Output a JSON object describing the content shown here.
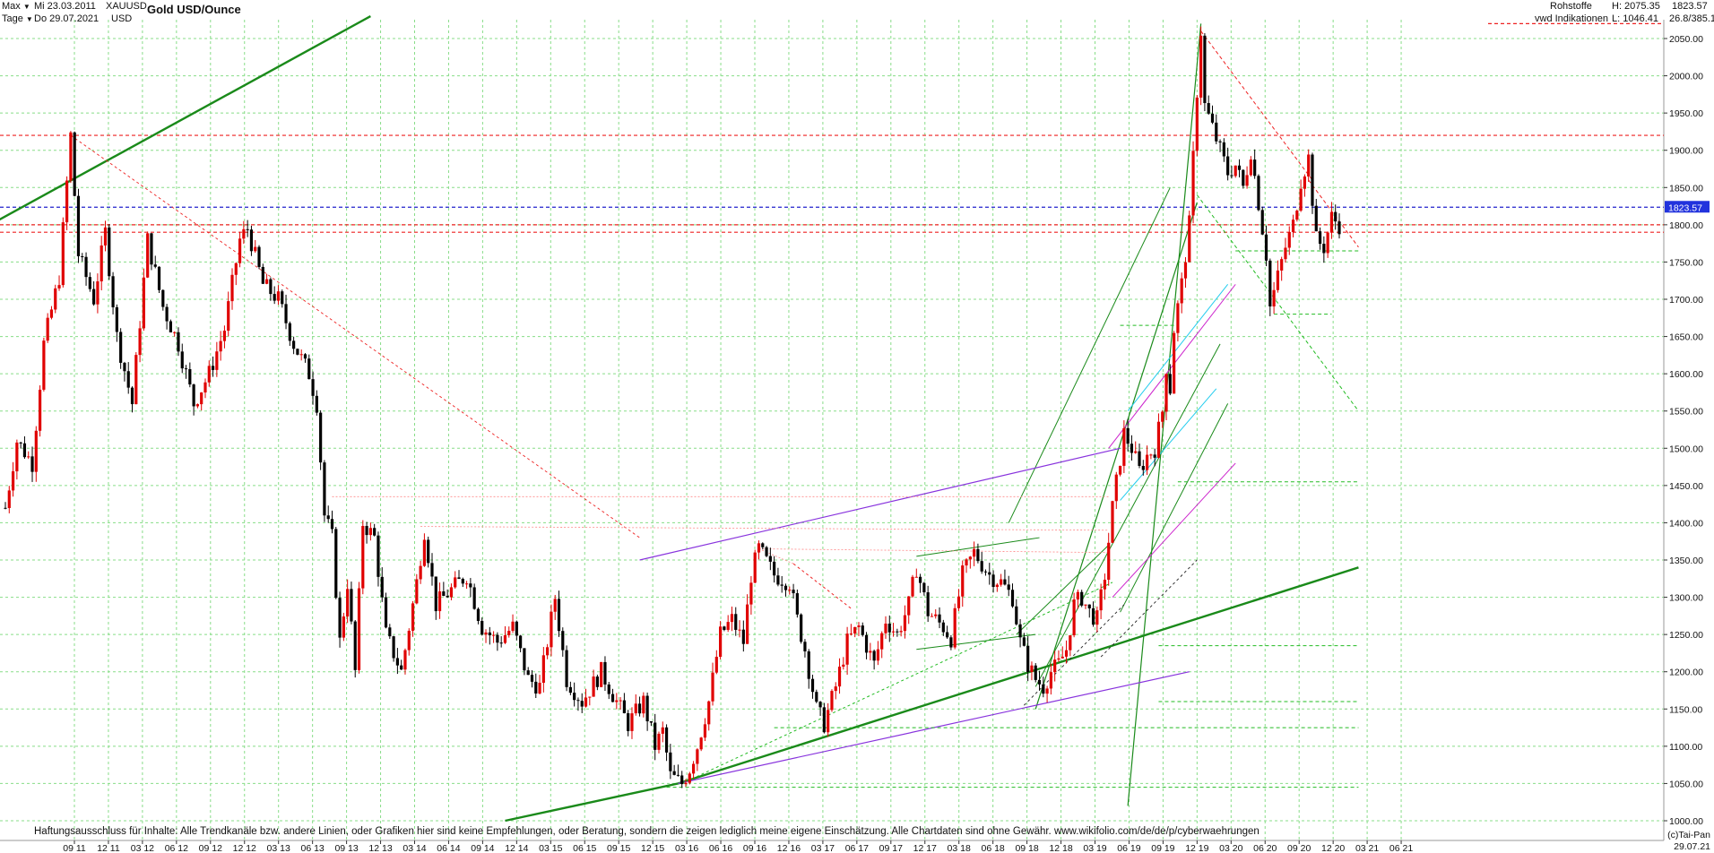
{
  "header": {
    "range_label": "Max",
    "interval_label": "Tage",
    "date_from": "Mi 23.03.2011",
    "date_to": "Do 29.07.2021",
    "symbol": "XAUUSD",
    "currency": "USD",
    "title": "Gold USD/Ounce",
    "category": "Rohstoffe",
    "source": "vwd Indikationen",
    "high": "H: 2075.35",
    "low": "L: 1046.41",
    "last": "1823.57",
    "ratio": "26.8/385.1"
  },
  "footer": {
    "disclaimer": "Haftungsausschluss für Inhalte: Alle Trendkanäle bzw. andere Linien, oder Grafiken hier sind keine Empfehlungen, oder Beratung, sondern die zeigen lediglich meine eigene Einschätzung. Alle Chartdaten sind ohne Gewähr.  www.wikifolio.com/de/de/p/cyberwaehrungen",
    "copyright": "(c)Tai-Pan",
    "end_date": "29.07.21"
  },
  "colors": {
    "background": "#ffffff",
    "grid": "#88dd88",
    "up_candle": "#e00000",
    "down_candle": "#000000",
    "trend_green": "#1a8a1a",
    "trend_purple": "#8833dd",
    "trend_magenta": "#cc22cc",
    "trend_cyan": "#22ccee",
    "resistance_red": "#ee2222",
    "price_line": "#2222cc",
    "price_badge": "#2233dd"
  },
  "chart_data": {
    "type": "candlestick",
    "title": "Gold USD/Ounce",
    "ylim": [
      1000,
      2080
    ],
    "y_ticks": [
      1000,
      1050,
      1100,
      1150,
      1200,
      1250,
      1300,
      1350,
      1400,
      1450,
      1500,
      1550,
      1600,
      1650,
      1700,
      1750,
      1800,
      1850,
      1900,
      1950,
      2000,
      2050
    ],
    "x_ticks": [
      "09 11",
      "12 11",
      "03 12",
      "06 12",
      "09 12",
      "12 12",
      "03 13",
      "06 13",
      "09 13",
      "12 13",
      "03 14",
      "06 14",
      "09 14",
      "12 14",
      "03 15",
      "06 15",
      "09 15",
      "12 15",
      "03 16",
      "06 16",
      "09 16",
      "12 16",
      "03 17",
      "06 17",
      "09 17",
      "12 17",
      "03 18",
      "06 18",
      "09 18",
      "12 18",
      "03 19",
      "06 19",
      "09 19",
      "12 19",
      "03 20",
      "06 20",
      "09 20",
      "12 20",
      "03 21",
      "06 21"
    ],
    "price_path": [
      [
        0,
        1420
      ],
      [
        3,
        1510
      ],
      [
        7,
        1480
      ],
      [
        10,
        1640
      ],
      [
        14,
        1730
      ],
      [
        17,
        1920
      ],
      [
        19,
        1760
      ],
      [
        23,
        1700
      ],
      [
        26,
        1790
      ],
      [
        29,
        1650
      ],
      [
        33,
        1560
      ],
      [
        37,
        1780
      ],
      [
        41,
        1690
      ],
      [
        45,
        1640
      ],
      [
        49,
        1560
      ],
      [
        53,
        1600
      ],
      [
        57,
        1660
      ],
      [
        61,
        1780
      ],
      [
        63,
        1795
      ],
      [
        67,
        1720
      ],
      [
        71,
        1700
      ],
      [
        75,
        1640
      ],
      [
        79,
        1600
      ],
      [
        81,
        1560
      ],
      [
        83,
        1410
      ],
      [
        85,
        1380
      ],
      [
        87,
        1240
      ],
      [
        89,
        1320
      ],
      [
        91,
        1200
      ],
      [
        93,
        1400
      ],
      [
        96,
        1380
      ],
      [
        99,
        1250
      ],
      [
        103,
        1200
      ],
      [
        107,
        1320
      ],
      [
        109,
        1390
      ],
      [
        112,
        1290
      ],
      [
        116,
        1310
      ],
      [
        120,
        1330
      ],
      [
        124,
        1260
      ],
      [
        128,
        1240
      ],
      [
        132,
        1260
      ],
      [
        136,
        1190
      ],
      [
        139,
        1180
      ],
      [
        143,
        1300
      ],
      [
        146,
        1190
      ],
      [
        150,
        1160
      ],
      [
        155,
        1200
      ],
      [
        158,
        1170
      ],
      [
        162,
        1130
      ],
      [
        166,
        1160
      ],
      [
        169,
        1100
      ],
      [
        171,
        1120
      ],
      [
        173,
        1060
      ],
      [
        176,
        1050
      ],
      [
        178,
        1070
      ],
      [
        180,
        1100
      ],
      [
        183,
        1160
      ],
      [
        186,
        1250
      ],
      [
        189,
        1270
      ],
      [
        192,
        1240
      ],
      [
        194,
        1330
      ],
      [
        196,
        1365
      ],
      [
        200,
        1330
      ],
      [
        204,
        1320
      ],
      [
        206,
        1270
      ],
      [
        208,
        1230
      ],
      [
        211,
        1150
      ],
      [
        213,
        1130
      ],
      [
        216,
        1180
      ],
      [
        219,
        1240
      ],
      [
        222,
        1260
      ],
      [
        226,
        1210
      ],
      [
        229,
        1270
      ],
      [
        232,
        1250
      ],
      [
        235,
        1290
      ],
      [
        237,
        1340
      ],
      [
        240,
        1280
      ],
      [
        244,
        1260
      ],
      [
        246,
        1245
      ],
      [
        249,
        1330
      ],
      [
        252,
        1360
      ],
      [
        256,
        1330
      ],
      [
        259,
        1320
      ],
      [
        262,
        1300
      ],
      [
        264,
        1240
      ],
      [
        266,
        1210
      ],
      [
        268,
        1190
      ],
      [
        270,
        1180
      ],
      [
        272,
        1200
      ],
      [
        274,
        1210
      ],
      [
        276,
        1230
      ],
      [
        278,
        1290
      ],
      [
        280,
        1300
      ],
      [
        282,
        1280
      ],
      [
        284,
        1270
      ],
      [
        286,
        1330
      ],
      [
        288,
        1420
      ],
      [
        291,
        1520
      ],
      [
        293,
        1500
      ],
      [
        295,
        1470
      ],
      [
        297,
        1490
      ],
      [
        299,
        1500
      ],
      [
        301,
        1550
      ],
      [
        302,
        1610
      ],
      [
        303,
        1580
      ],
      [
        304,
        1660
      ],
      [
        305,
        1690
      ],
      [
        306,
        1720
      ],
      [
        307,
        1760
      ],
      [
        308,
        1800
      ],
      [
        310,
        1980
      ],
      [
        311,
        2060
      ],
      [
        312,
        1960
      ],
      [
        314,
        1930
      ],
      [
        316,
        1900
      ],
      [
        318,
        1870
      ],
      [
        320,
        1880
      ],
      [
        322,
        1850
      ],
      [
        324,
        1900
      ],
      [
        326,
        1830
      ],
      [
        328,
        1760
      ],
      [
        329,
        1690
      ],
      [
        331,
        1730
      ],
      [
        333,
        1770
      ],
      [
        335,
        1800
      ],
      [
        337,
        1860
      ],
      [
        339,
        1890
      ],
      [
        341,
        1780
      ],
      [
        343,
        1770
      ],
      [
        345,
        1810
      ],
      [
        347,
        1800
      ]
    ],
    "x_index_count": 348,
    "price_markers": {
      "current": 1823.57,
      "high": 2075.35,
      "low": 1046.41
    },
    "horizontal_levels": [
      {
        "value": 2070,
        "color": "red"
      },
      {
        "value": 1920,
        "color": "red"
      },
      {
        "value": 1823.57,
        "color": "blue"
      },
      {
        "value": 1800,
        "color": "red"
      },
      {
        "value": 1790,
        "color": "red"
      }
    ]
  }
}
